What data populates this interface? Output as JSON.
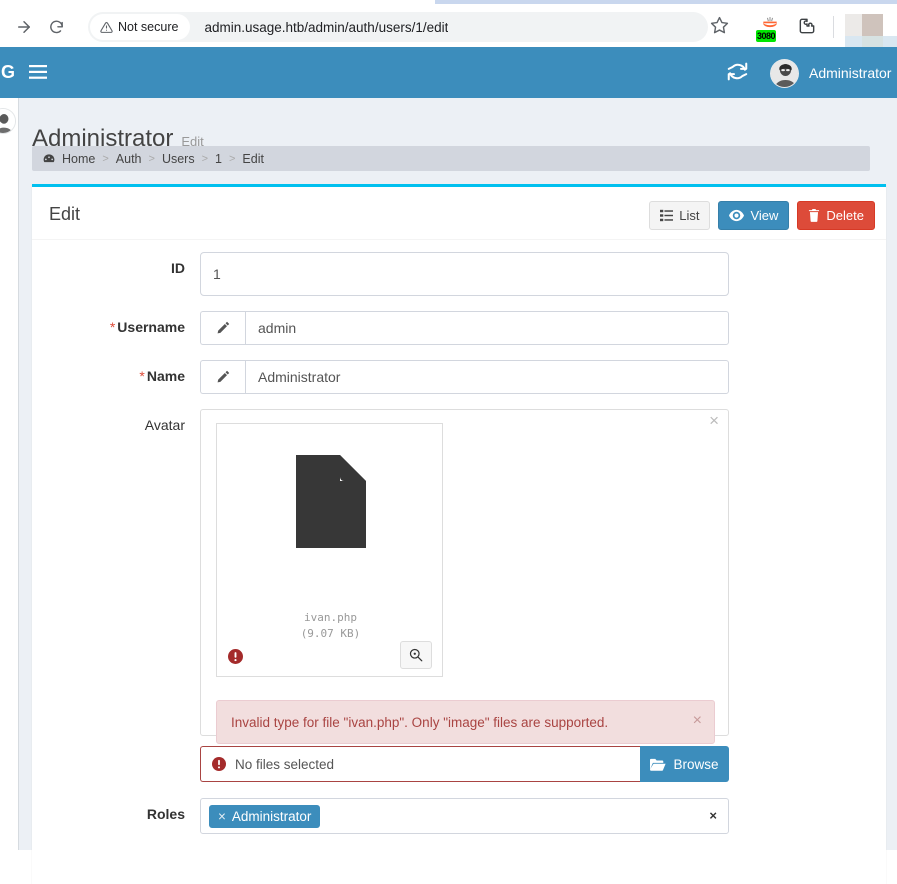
{
  "browser": {
    "forward_icon": "arrow-forward-icon",
    "reload_icon": "reload-icon",
    "security_label": "Not secure",
    "security_icon": "warning-triangle-icon",
    "url": "admin.usage.htb/admin/auth/users/1/edit",
    "bookmark_icon": "star-icon",
    "extension_badge": "3080",
    "extension_icon": "burp-suite-icon",
    "puzzle_icon": "extensions-puzzle-icon",
    "profile_icon": "profile-avatar-chip"
  },
  "navbar": {
    "logo_text": "G",
    "toggle_icon": "hamburger-menu-icon",
    "refresh_icon": "refresh-icon",
    "user_name": "Administrator",
    "avatar_icon": "user-avatar",
    "bg_color": "#3c8dbc"
  },
  "content_header": {
    "title": "Administrator",
    "subtitle": "Edit"
  },
  "breadcrumb": {
    "home_icon": "dashboard-icon",
    "separator": ">",
    "items": [
      {
        "label": "Home"
      },
      {
        "label": "Auth"
      },
      {
        "label": "Users"
      },
      {
        "label": "1"
      },
      {
        "label": "Edit"
      }
    ]
  },
  "box": {
    "accent_color": "#00c0ef",
    "title": "Edit",
    "tools": [
      {
        "label": "List",
        "icon": "list-icon",
        "style": "default"
      },
      {
        "label": "View",
        "icon": "eye-icon",
        "style": "primary"
      },
      {
        "label": "Delete",
        "icon": "trash-icon",
        "style": "danger"
      }
    ]
  },
  "form": {
    "id_field": {
      "label": "ID",
      "value": "1"
    },
    "username_field": {
      "label": "Username",
      "required": true,
      "required_mark": "*",
      "addon_icon": "pencil-icon",
      "value": "admin"
    },
    "name_field": {
      "label": "Name",
      "required": true,
      "required_mark": "*",
      "addon_icon": "pencil-icon",
      "value": "Administrator"
    },
    "avatar_field": {
      "label": "Avatar",
      "panel_close_icon": "close-icon",
      "panel_close_label": "×",
      "file_card": {
        "thumb_icon": "file-generic-icon",
        "file_name": "ivan.php",
        "file_size": "(9.07 KB)",
        "error_icon": "error-circle-icon",
        "zoom_icon": "zoom-in-icon"
      },
      "alert": {
        "message": "Invalid type for file \"ivan.php\". Only \"image\" files are supported.",
        "close_label": "×",
        "bg_color": "#f2dede",
        "text_color": "#a94442"
      },
      "file_input": {
        "status_icon": "error-circle-icon",
        "status_text": "No files selected",
        "browse_label": "Browse",
        "browse_icon": "folder-open-icon",
        "border_color": "#a94442"
      }
    },
    "roles_field": {
      "label": "Roles",
      "tags": [
        {
          "remove_label": "×",
          "label": "Administrator"
        }
      ],
      "clear_label": "×"
    }
  }
}
